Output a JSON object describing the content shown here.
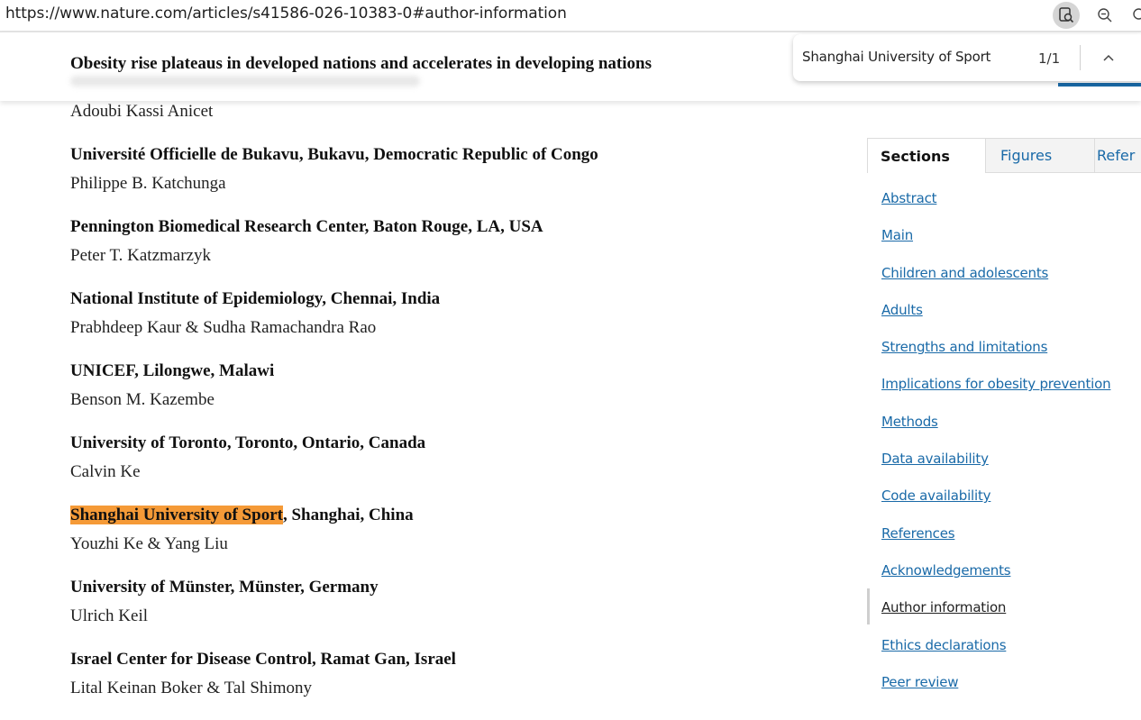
{
  "browser": {
    "url": "https://www.nature.com/articles/s41586-026-10383-0#author-information"
  },
  "sticky_header": {
    "title": "Obesity rise plateaus in developed nations and accelerates in developing nations"
  },
  "find_bar": {
    "query": "Shanghai University of Sport",
    "count": "1/1"
  },
  "content": {
    "lead_author": "Adoubi Kassi Anicet",
    "affiliations": [
      {
        "name": "Université Officielle de Bukavu, Bukavu, Democratic Republic of Congo",
        "authors": "Philippe B. Katchunga"
      },
      {
        "name": "Pennington Biomedical Research Center, Baton Rouge, LA, USA",
        "authors": "Peter T. Katzmarzyk"
      },
      {
        "name": "National Institute of Epidemiology, Chennai, India",
        "authors": "Prabhdeep Kaur & Sudha Ramachandra Rao"
      },
      {
        "name": "UNICEF, Lilongwe, Malawi",
        "authors": "Benson M. Kazembe"
      },
      {
        "name": "University of Toronto, Toronto, Ontario, Canada",
        "authors": "Calvin Ke"
      },
      {
        "name_highlight": "Shanghai University of Sport",
        "name_rest": ", Shanghai, China",
        "authors": "Youzhi Ke & Yang Liu"
      },
      {
        "name": "University of Münster, Münster, Germany",
        "authors": "Ulrich Keil"
      },
      {
        "name": "Israel Center for Disease Control, Ramat Gan, Israel",
        "authors": "Lital Keinan Boker & Tal Shimony"
      }
    ]
  },
  "sidebar": {
    "tabs": [
      "Sections",
      "Figures",
      "Refer"
    ],
    "sections": [
      "Abstract",
      "Main",
      "Children and adolescents",
      "Adults",
      "Strengths and limitations",
      "Implications for obesity prevention",
      "Methods",
      "Data availability",
      "Code availability",
      "References",
      "Acknowledgements",
      "Author information",
      "Ethics declarations",
      "Peer review"
    ]
  },
  "colors": {
    "link": "#1a6aa8",
    "find_highlight": "#f59a37"
  }
}
